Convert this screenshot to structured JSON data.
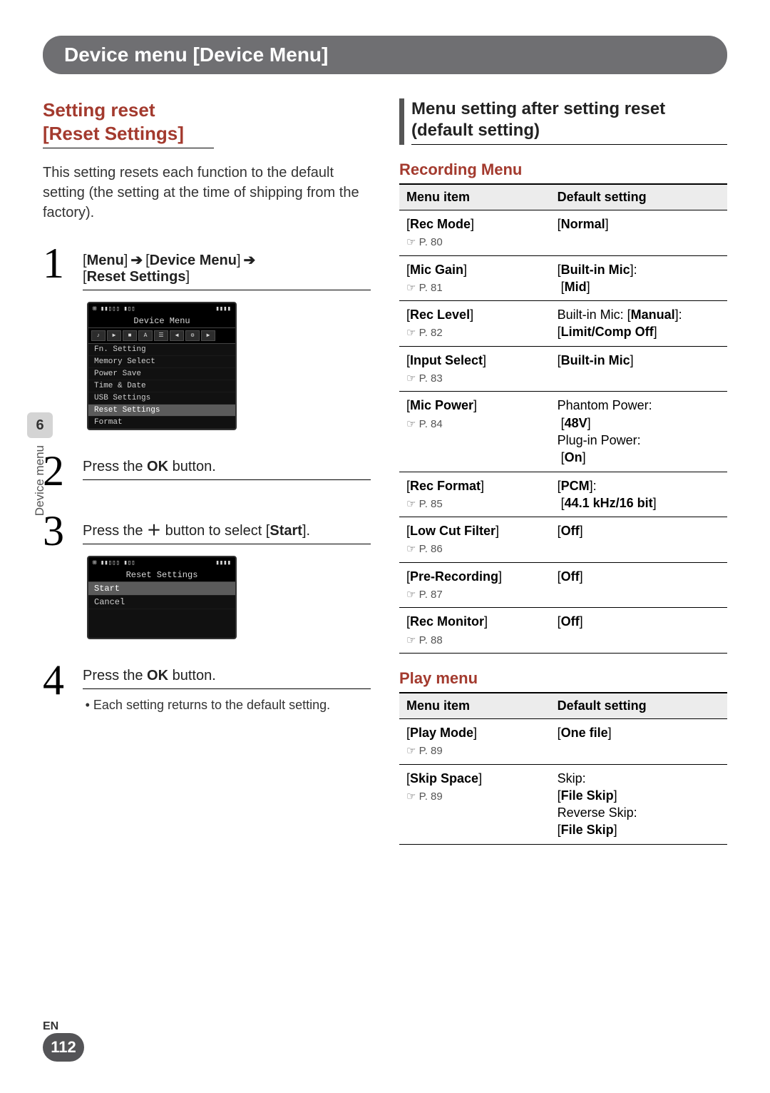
{
  "header": {
    "title": "Device menu [Device Menu]"
  },
  "left": {
    "section_title_line1": "Setting reset",
    "section_title_line2": " [Reset Settings]",
    "intro": "This setting resets each function to the default setting (the setting at the time of shipping from the factory).",
    "step1": {
      "num": "1",
      "p1": "[",
      "menu": "Menu",
      "arrow": " ➔ ",
      "b1": "] ",
      "device_menu": "Device Menu",
      "b2": "] ",
      "reset": "Reset Settings",
      "close": "]"
    },
    "lcd1": {
      "title": "Device Menu",
      "items": [
        "Fn. Setting",
        "Memory Select",
        "Power Save",
        "Time & Date",
        "USB Settings",
        "Reset Settings",
        "Format"
      ],
      "selected_index": 5,
      "icons": [
        "♪",
        "▶",
        "■",
        "A",
        "☰",
        "◀",
        "⚙",
        "▶"
      ]
    },
    "step2": {
      "num": "2",
      "pre": "Press the ",
      "btn": "OK",
      "post": " button."
    },
    "step3": {
      "num": "3",
      "pre": "Press the ",
      "btn": "＋",
      "mid": " button to select [",
      "start": "Start",
      "post": "]."
    },
    "lcd2": {
      "title": "Reset Settings",
      "items": [
        "Start",
        "Cancel"
      ],
      "selected_index": 0
    },
    "step4": {
      "num": "4",
      "pre": "Press the ",
      "btn": "OK",
      "post": " button.",
      "bullet": "• Each setting returns to the default setting."
    }
  },
  "right": {
    "heading": "Menu setting after setting reset (default setting)",
    "recording_heading": "Recording Menu",
    "table_headers": {
      "item": "Menu item",
      "default": "Default setting"
    },
    "recording_rows": [
      {
        "name": "Rec Mode",
        "page": "P. 80",
        "default_plain": "",
        "default_bold": "Normal"
      },
      {
        "name": "Mic Gain",
        "page": "P. 81",
        "default_plain_pre": "[",
        "default_bold_pre": "Built-in Mic",
        "default_plain_mid": "]:",
        "line2_bold": "Mid"
      },
      {
        "name": "Rec Level",
        "page": "P. 82",
        "default_plain_pre": "Built-in Mic: [",
        "default_bold_pre": "Manual",
        "default_plain_mid": "]:",
        "line2_bold": "Limit/Comp Off"
      },
      {
        "name": "Input Select",
        "page": "P. 83",
        "default_plain": "",
        "default_bold": "Built-in Mic"
      },
      {
        "name": "Mic Power",
        "page": "P. 84",
        "d1_plain": "Phantom Power:",
        "d1_bold": "48V",
        "d2_plain": "Plug-in Power:",
        "d2_bold": "On"
      },
      {
        "name": "Rec Format",
        "page": "P. 85",
        "default_plain_pre": "[",
        "default_bold_pre": "PCM",
        "default_plain_mid": "]:",
        "line2_bold": "44.1 kHz/16 bit"
      },
      {
        "name": "Low Cut Filter",
        "page": "P. 86",
        "default_plain": "",
        "default_bold": "Off"
      },
      {
        "name": "Pre-Recording",
        "page": "P. 87",
        "default_plain": "",
        "default_bold": "Off"
      },
      {
        "name": "Rec Monitor",
        "page": "P. 88",
        "default_plain": "",
        "default_bold": "Off"
      }
    ],
    "play_heading": "Play menu",
    "play_rows": [
      {
        "name": "Play Mode",
        "page": "P. 89",
        "default_bold": "One file"
      },
      {
        "name": "Skip Space",
        "page": "P. 89",
        "d1_plain": "Skip:",
        "d1_bold": "File Skip",
        "d2_plain": "Reverse Skip:",
        "d2_bold": "File Skip"
      }
    ]
  },
  "side": {
    "chapter": "6",
    "label": "Device menu"
  },
  "footer": {
    "lang": "EN",
    "page": "112"
  }
}
